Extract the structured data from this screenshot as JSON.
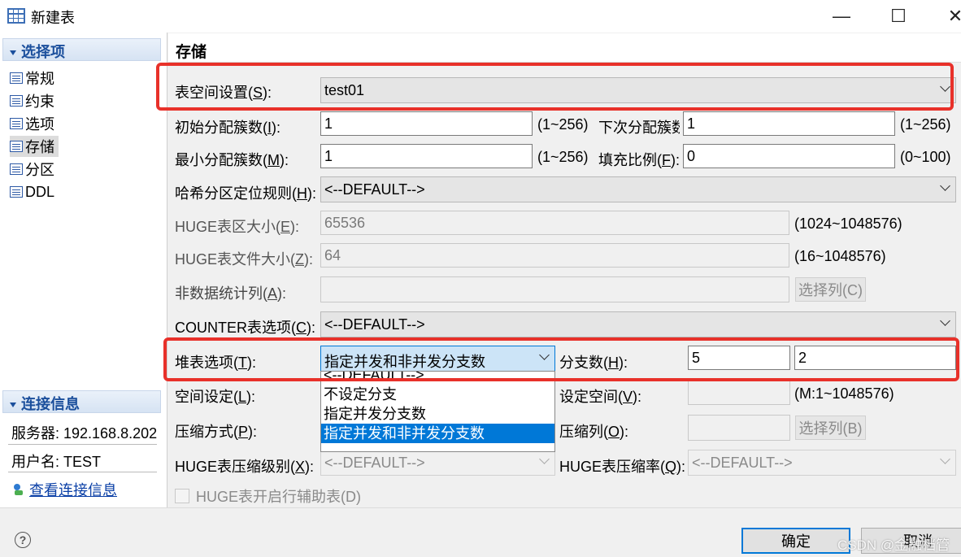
{
  "window": {
    "title": "新建表",
    "minimize": "—",
    "maximize": "☐",
    "close": "✕"
  },
  "sidebar": {
    "section_title": "选择项",
    "items": [
      {
        "label": "常规"
      },
      {
        "label": "约束"
      },
      {
        "label": "选项"
      },
      {
        "label": "存储",
        "selected": true
      },
      {
        "label": "分区"
      },
      {
        "label": "DDL"
      }
    ],
    "conn_title": "连接信息",
    "server_label": "服务器: 192.168.8.202",
    "user_label": "用户名: TEST",
    "view_conn_link": "查看连接信息"
  },
  "main": {
    "title": "存储",
    "tablespace": {
      "label": "表空间设置(",
      "key": "S",
      "suffix": "):",
      "value": "test01"
    },
    "init_extents": {
      "label": "初始分配簇数(",
      "key": "I",
      "suffix": "):",
      "value": "1",
      "range": "(1~256)"
    },
    "next_extents": {
      "label": "下次分配簇数(",
      "key": "N",
      "suffix": "):",
      "value": "1",
      "range": "(1~256)"
    },
    "min_extents": {
      "label": "最小分配簇数(",
      "key": "M",
      "suffix": "):",
      "value": "1",
      "range": "(1~256)"
    },
    "fill_factor": {
      "label": "填充比例(",
      "key": "F",
      "suffix": "):",
      "value": "0",
      "range": "(0~100)"
    },
    "hash_rule": {
      "label": "哈希分区定位规则(",
      "key": "H",
      "suffix": "):",
      "value": "<--DEFAULT-->"
    },
    "huge_region": {
      "label": "HUGE表区大小(",
      "key": "E",
      "suffix": "):",
      "value": "65536",
      "range": "(1024~1048576)"
    },
    "huge_file": {
      "label": "HUGE表文件大小(",
      "key": "Z",
      "suffix": "):",
      "value": "64",
      "range": "(16~1048576)"
    },
    "nonstat_cols": {
      "label": "非数据统计列(",
      "key": "A",
      "suffix": "):",
      "value": "",
      "button": "选择列(C)"
    },
    "counter": {
      "label": "COUNTER表选项(",
      "key": "C",
      "suffix": "):",
      "value": "<--DEFAULT-->"
    },
    "heap": {
      "label": "堆表选项(",
      "key": "T",
      "suffix": "):",
      "value": "指定并发和非并发分支数"
    },
    "branch": {
      "label": "分支数(",
      "key": "H",
      "suffix": "):",
      "value1": "5",
      "value2": "2"
    },
    "space_setting": {
      "label": "空间设定(",
      "key": "L",
      "suffix": "):"
    },
    "set_space": {
      "label": "设定空间(",
      "key": "V",
      "suffix": "):",
      "value": "",
      "range": "(M:1~1048576)"
    },
    "compress_mode": {
      "label": "压缩方式(",
      "key": "P",
      "suffix": "):"
    },
    "compress_cols": {
      "label": "压缩列(",
      "key": "O",
      "suffix": "):",
      "value": "",
      "button": "选择列(B)"
    },
    "huge_compress_level": {
      "label": "HUGE表压缩级别(",
      "key": "X",
      "suffix": "):",
      "value": "<--DEFAULT-->"
    },
    "huge_compress_rate": {
      "label": "HUGE表压缩率(",
      "key": "Q",
      "suffix": "):",
      "value": "<--DEFAULT-->"
    },
    "huge_aux": {
      "label": "HUGE表开启行辅助表(D)",
      "checked": false
    }
  },
  "heap_dropdown": {
    "options": [
      "<--DEFAULT-->",
      "不设定分支",
      "指定并发分支数",
      "指定并发和非并发分支数"
    ],
    "selected_index": 3
  },
  "footer": {
    "help": "?",
    "ok": "确定",
    "cancel": "取消",
    "watermark": "CSDN @金融档管"
  },
  "colors": {
    "highlight_red": "#e8312a",
    "selection_blue": "#0078d7",
    "sidebar_header": "#1b4f9c"
  }
}
